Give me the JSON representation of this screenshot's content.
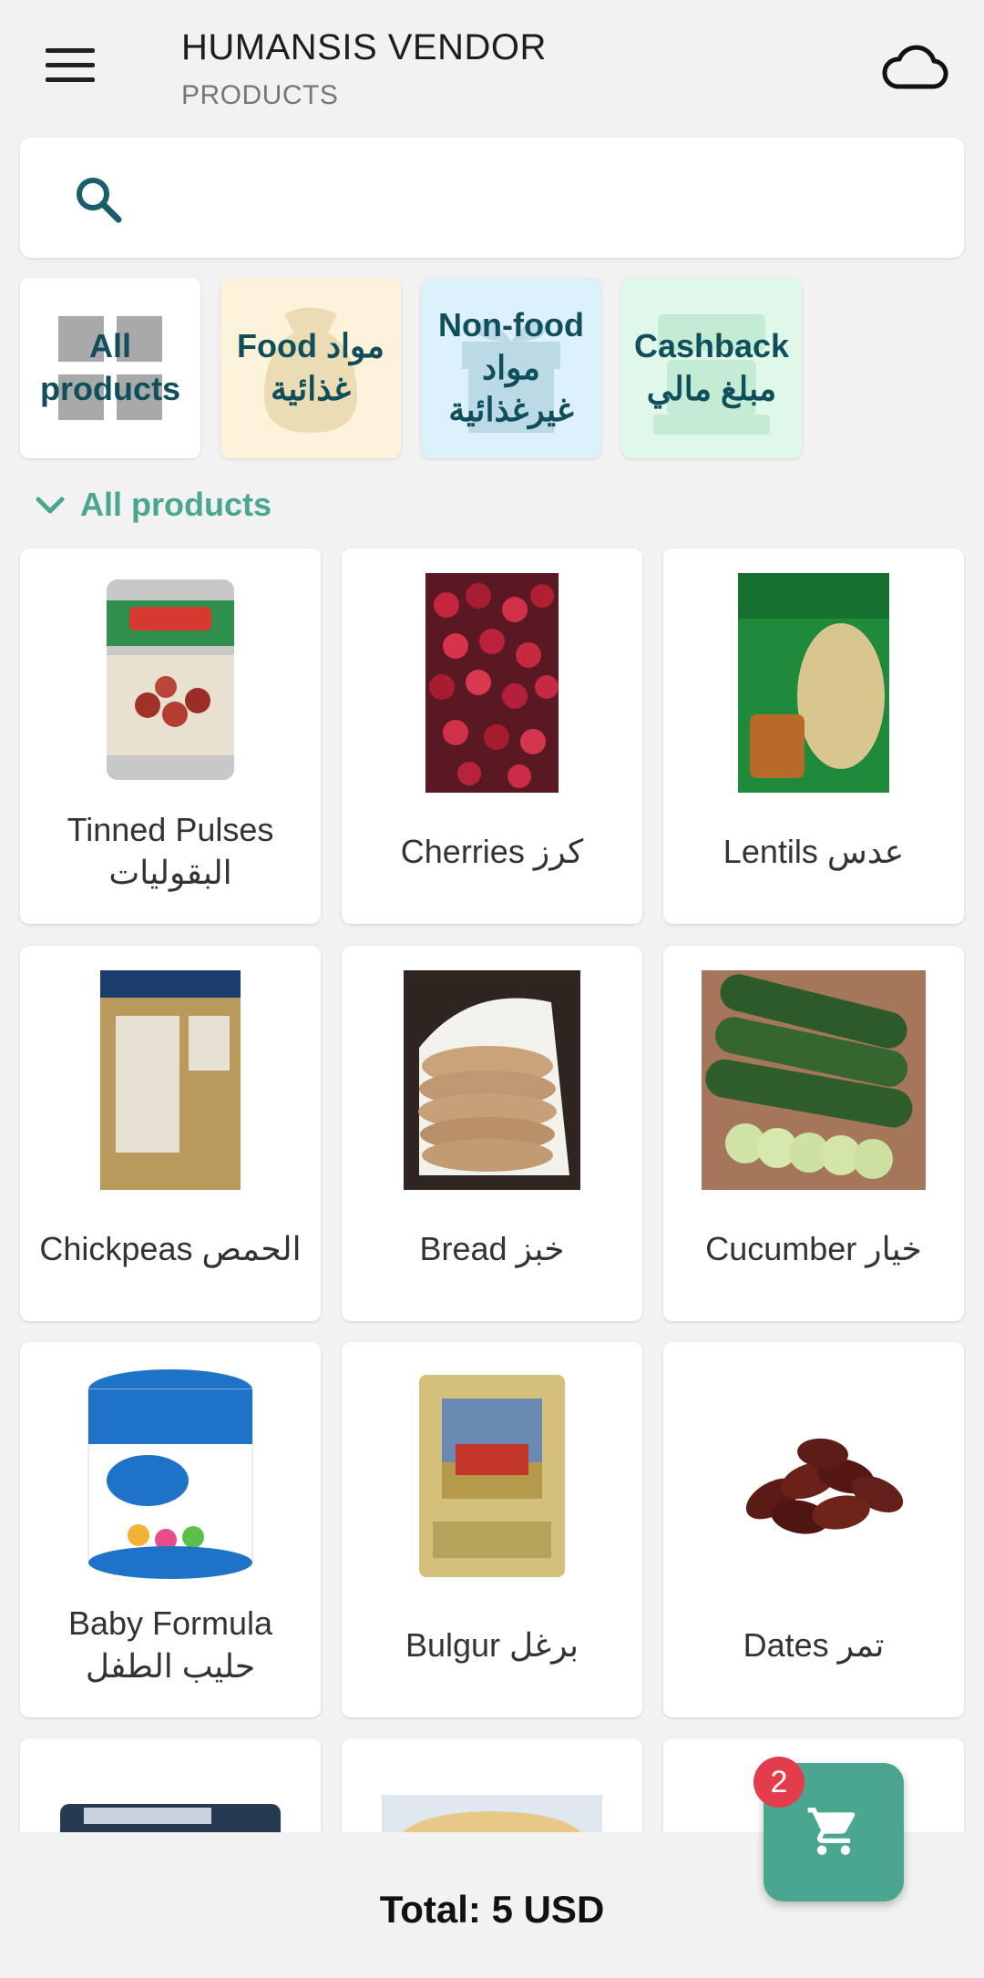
{
  "header": {
    "title": "HUMANSIS VENDOR",
    "subtitle": "PRODUCTS",
    "menu_icon": "hamburger-menu-icon",
    "sync_icon": "cloud-icon"
  },
  "search": {
    "placeholder": "",
    "value": "",
    "icon": "search-icon"
  },
  "categories": [
    {
      "label": "All products",
      "icon": "grid-icon",
      "color": "#ffffff"
    },
    {
      "label": "Food مواد غذائية",
      "icon": "food-bag-icon",
      "color": "#fdf3db"
    },
    {
      "label": "Non-food مواد غيرغذائية",
      "icon": "gift-box-icon",
      "color": "#dcf1fb"
    },
    {
      "label": "Cashback مبلغ مالي",
      "icon": "cash-register-icon",
      "color": "#dff8ea"
    }
  ],
  "section": {
    "title": "All products",
    "icon": "chevron-down-icon"
  },
  "products": [
    {
      "name": "Tinned Pulses البقوليات",
      "image": "tinned-pulses-image"
    },
    {
      "name": "Cherries كرز",
      "image": "cherries-image"
    },
    {
      "name": "Lentils عدس",
      "image": "lentils-image"
    },
    {
      "name": "Chickpeas الحمص",
      "image": "chickpeas-image"
    },
    {
      "name": "Bread خبز",
      "image": "bread-image"
    },
    {
      "name": "Cucumber خيار",
      "image": "cucumber-image"
    },
    {
      "name": "Baby Formula حليب الطفل",
      "image": "baby-formula-image"
    },
    {
      "name": "Bulgur برغل",
      "image": "bulgur-image"
    },
    {
      "name": "Dates تمر",
      "image": "dates-image"
    }
  ],
  "cart": {
    "badge_count": "2",
    "icon": "shopping-cart-icon",
    "accent": "#4aa68f",
    "badge_color": "#e23c4d"
  },
  "footer": {
    "total": "Total: 5 USD"
  }
}
